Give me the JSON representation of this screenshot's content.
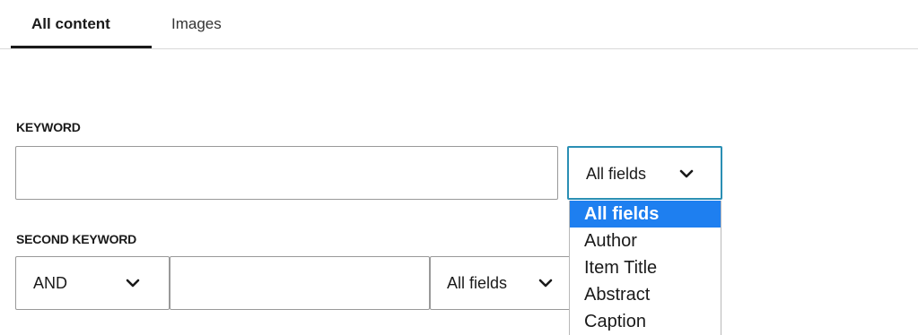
{
  "tabs": [
    {
      "label": "All content",
      "active": true
    },
    {
      "label": "Images",
      "active": false
    }
  ],
  "keyword": {
    "label": "KEYWORD",
    "value": "",
    "field_select": "All fields"
  },
  "second_keyword": {
    "label": "SECOND KEYWORD",
    "operator": "AND",
    "value": "",
    "field_select": "All fields"
  },
  "field_dropdown": {
    "options": [
      "All fields",
      "Author",
      "Item Title",
      "Abstract",
      "Caption"
    ],
    "selected": "All fields"
  },
  "colors": {
    "focus_border": "#2a8fb4",
    "option_highlight": "#1e7ff0"
  },
  "icons": {
    "chevron": "chevron-down-icon"
  }
}
